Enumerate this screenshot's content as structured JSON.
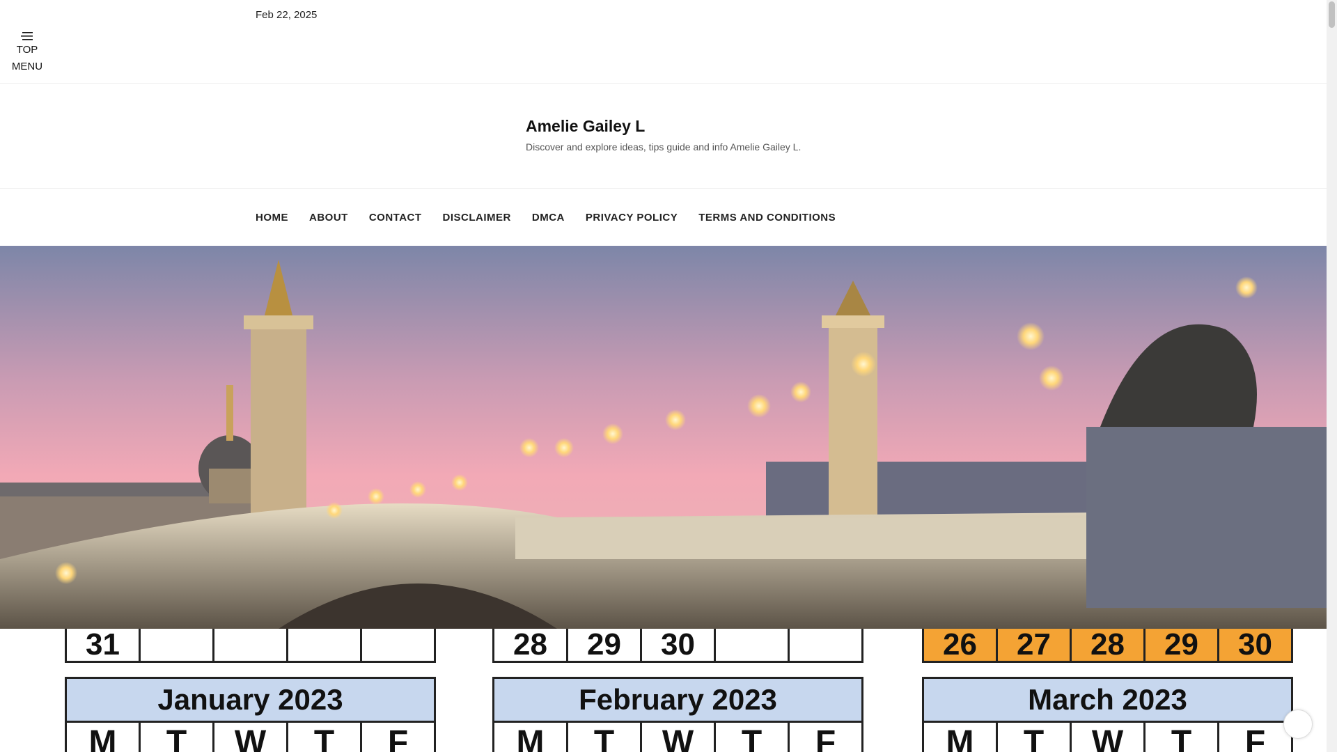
{
  "header": {
    "date": "Feb 22, 2025",
    "menu_toggle_label_line1": "TOP",
    "menu_toggle_label_line2": "MENU"
  },
  "branding": {
    "site_title": "Amelie Gailey L",
    "site_description": "Discover and explore ideas, tips guide and info Amelie Gailey L."
  },
  "nav": {
    "items": [
      {
        "label": "HOME"
      },
      {
        "label": "ABOUT"
      },
      {
        "label": "CONTACT"
      },
      {
        "label": "DISCLAIMER"
      },
      {
        "label": "DMCA"
      },
      {
        "label": "PRIVACY POLICY"
      },
      {
        "label": "TERMS AND CONDITIONS"
      }
    ]
  },
  "hero": {
    "icon": "pont-alexandre-iii-photo"
  },
  "calendars": [
    {
      "prev_row": [
        "31",
        "",
        "",
        "",
        ""
      ],
      "title": "January 2023",
      "weekdays": [
        "M",
        "T",
        "W",
        "T",
        "F"
      ]
    },
    {
      "prev_row": [
        "28",
        "29",
        "30",
        "",
        ""
      ],
      "title": "February 2023",
      "weekdays": [
        "M",
        "T",
        "W",
        "T",
        "F"
      ]
    },
    {
      "prev_row": [
        "26",
        "27",
        "28",
        "29",
        "30"
      ],
      "title": "March 2023",
      "weekdays": [
        "M",
        "T",
        "W",
        "T",
        "F"
      ]
    }
  ],
  "colors": {
    "calendar_header": "#c7d7ee",
    "calendar_highlight": "#f4a334",
    "sky_top": "#7d86a8",
    "sky_pink": "#f2a9b6"
  }
}
